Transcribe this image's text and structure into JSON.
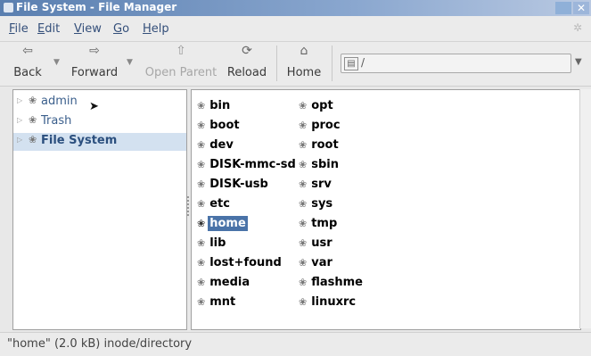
{
  "window": {
    "title": "File System - File Manager"
  },
  "menubar": {
    "items": [
      {
        "label": "File",
        "accel": "F",
        "rest": "ile"
      },
      {
        "label": "Edit",
        "accel": "E",
        "rest": "dit"
      },
      {
        "label": "View",
        "accel": "V",
        "rest": "iew"
      },
      {
        "label": "Go",
        "accel": "G",
        "rest": "o"
      },
      {
        "label": "Help",
        "accel": "H",
        "rest": "elp"
      }
    ]
  },
  "toolbar": {
    "back": "Back",
    "forward": "Forward",
    "open_parent": "Open Parent",
    "reload": "Reload",
    "home": "Home"
  },
  "location": {
    "value": "/"
  },
  "sidebar": {
    "items": [
      {
        "label": "admin"
      },
      {
        "label": "Trash"
      },
      {
        "label": "File System",
        "selected": true
      }
    ]
  },
  "files": {
    "col1": [
      "bin",
      "boot",
      "dev",
      "DISK-mmc-sd",
      "DISK-usb",
      "etc",
      "home",
      "lib",
      "lost+found",
      "media",
      "mnt"
    ],
    "col2": [
      "opt",
      "proc",
      "root",
      "sbin",
      "srv",
      "sys",
      "tmp",
      "usr",
      "var",
      "flashme",
      "linuxrc"
    ],
    "selected": "home"
  },
  "status": {
    "text": "\"home\" (2.0 kB) inode/directory"
  }
}
